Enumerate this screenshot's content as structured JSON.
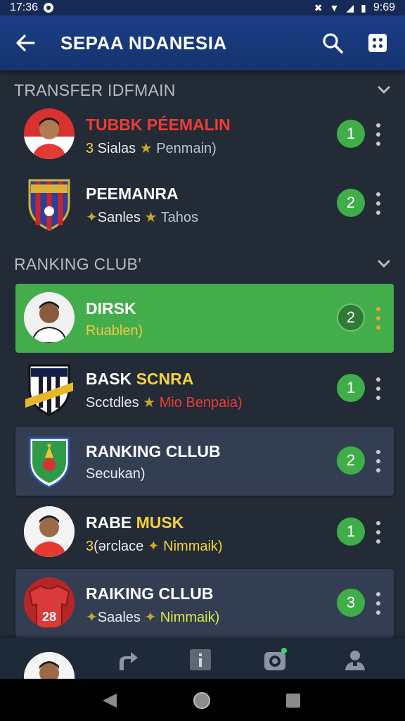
{
  "status_bar": {
    "time_left": "17:36",
    "time_right": "9:69"
  },
  "app_bar": {
    "title": "SEPAA NDANESIA",
    "back_icon": "arrow-left-icon",
    "search_icon": "search-icon",
    "menu_icon": "grid-menu-icon"
  },
  "sections": [
    {
      "title": "TRANSFER IDFMAIN"
    },
    {
      "title": "RANKING CLUB’"
    }
  ],
  "transfer_items": [
    {
      "name_a": "TUBBK",
      "name_b": " PÉEMALIN",
      "sub_a": "3",
      "sub_b": " Sialas ",
      "sub_star": "★",
      "sub_c": " Penmain)",
      "badge": "1"
    },
    {
      "name_a": "PEEMANRA",
      "name_b": "",
      "sub_a": "",
      "sub_b": "Sanles ",
      "sub_star": "★",
      "sub_c": " Tahos",
      "badge": "2"
    }
  ],
  "ranking_items": [
    {
      "name_a": "DIRSK",
      "name_b": "",
      "sub_a": "Ruablen)",
      "sub_b": "",
      "sub_star": "",
      "sub_c": "",
      "badge": "2"
    },
    {
      "name_a": "BASK ",
      "name_b": "SCNRA",
      "sub_a": "Scctdles ",
      "sub_b": "",
      "sub_star": "★",
      "sub_c": " Mio Benpaia)",
      "badge": "1"
    },
    {
      "name_a": "RANKING CLLUB",
      "name_b": "",
      "sub_a": "Secukan)",
      "sub_b": "",
      "sub_star": "",
      "sub_c": "",
      "badge": "2"
    },
    {
      "name_a": "RABE ",
      "name_b": "MUSK",
      "sub_a": "3",
      "sub_b": "(ərclace ",
      "sub_star": "✦",
      "sub_c": " Nimmaik)",
      "badge": "1"
    },
    {
      "name_a": "RAIKING CLLUB",
      "name_b": "",
      "sub_a": "",
      "sub_b": "Saales ",
      "sub_star": "✦",
      "sub_c": " Nimmaik)",
      "badge": "3",
      "jersey_number": "28"
    }
  ],
  "bottom_nav": [
    {
      "icon": "avatar-icon"
    },
    {
      "icon": "turn-arrow-icon"
    },
    {
      "icon": "info-icon"
    },
    {
      "icon": "camera-icon"
    },
    {
      "icon": "person-icon"
    }
  ],
  "system_nav": {
    "back": "back-triangle-icon",
    "home": "home-circle-icon",
    "recents": "recents-square-icon"
  },
  "colors": {
    "app_bar": "#15346f",
    "highlight_row": "#43ad4c",
    "badge": "#3fae49",
    "background": "#222b36",
    "card": "#333e52"
  }
}
